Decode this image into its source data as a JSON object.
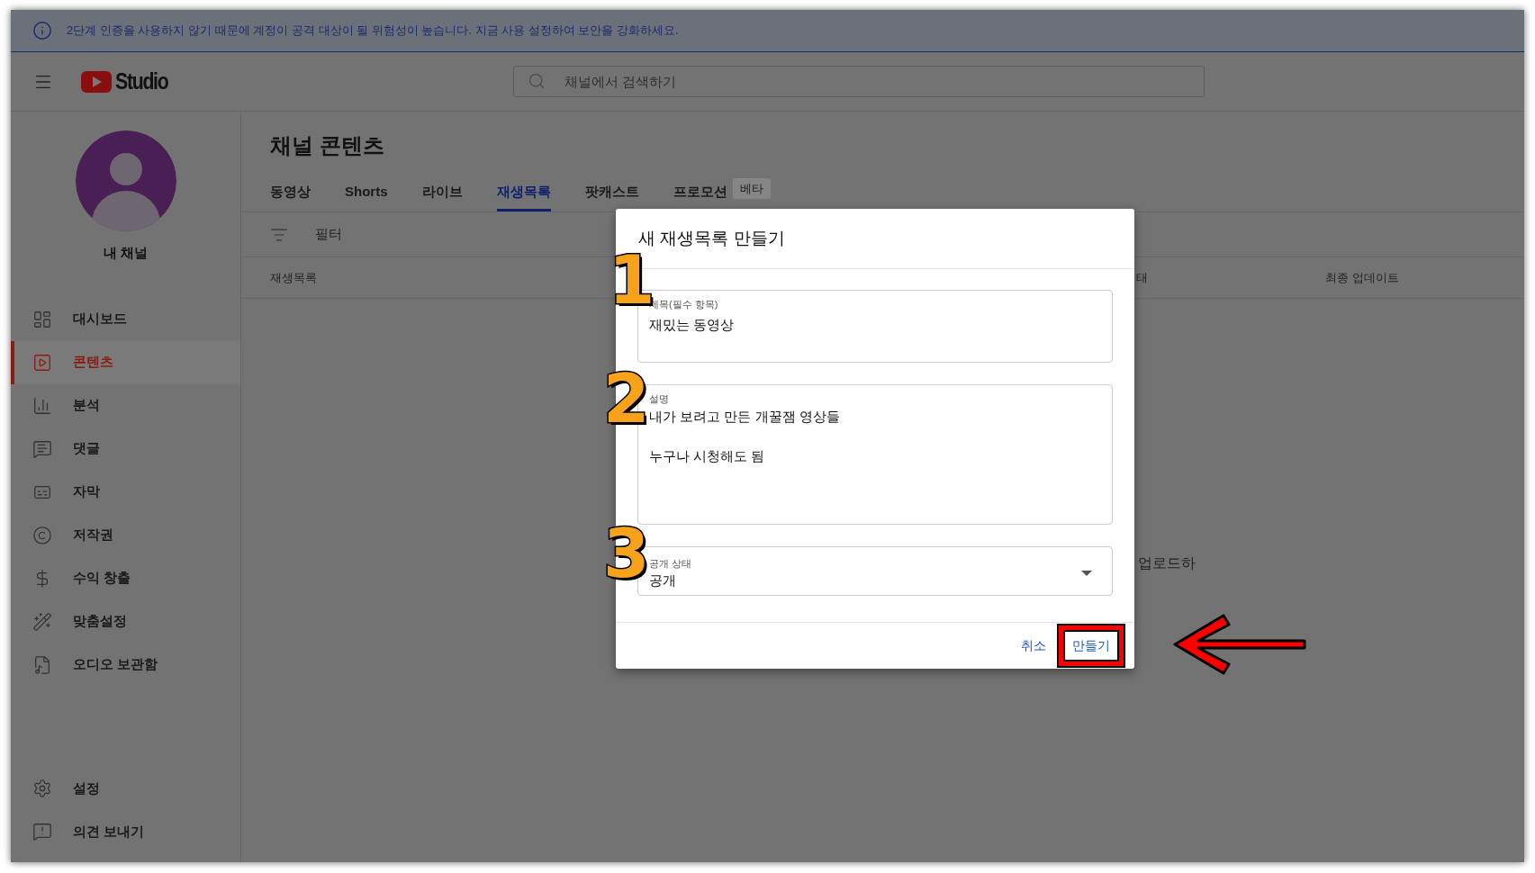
{
  "banner": {
    "text": "2단계 인증을 사용하지 않기 때문에 계정이 공격 대상이 될 위험성이 높습니다. 지금 사용 설정하여 보안을 강화하세요."
  },
  "header": {
    "logo": "Studio",
    "search": {
      "placeholder": "채널에서 검색하기"
    }
  },
  "sidebar": {
    "channel_name": "내 채널",
    "items": [
      {
        "label": "대시보드",
        "selected": false
      },
      {
        "label": "콘텐츠",
        "selected": true
      },
      {
        "label": "분석",
        "selected": false
      },
      {
        "label": "댓글",
        "selected": false
      },
      {
        "label": "자막",
        "selected": false
      },
      {
        "label": "저작권",
        "selected": false
      },
      {
        "label": "수익 창출",
        "selected": false
      },
      {
        "label": "맞춤설정",
        "selected": false
      },
      {
        "label": "오디오 보관함",
        "selected": false
      }
    ],
    "bottom_items": [
      {
        "label": "설정"
      },
      {
        "label": "의견 보내기"
      }
    ]
  },
  "page": {
    "title": "채널 콘텐츠",
    "tabs": [
      {
        "label": "동영상",
        "selected": false
      },
      {
        "label": "Shorts",
        "selected": false
      },
      {
        "label": "라이브",
        "selected": false
      },
      {
        "label": "재생목록",
        "selected": true
      },
      {
        "label": "팟캐스트",
        "selected": false
      },
      {
        "label": "프로모션",
        "selected": false,
        "badge": "베타"
      }
    ],
    "filter": "필터",
    "columns": [
      "재생목록",
      "태",
      "최종 업데이트"
    ],
    "empty_text": "업로드하"
  },
  "dialog": {
    "title": "새 재생목록 만들기",
    "title_field": {
      "label": "제목(필수 항목)",
      "value": "재밌는 동영상"
    },
    "description_field": {
      "label": "설명",
      "paragraphs": [
        "내가 보려고 만든 개꿀잼 영상들",
        "누구나 시청해도 됨"
      ]
    },
    "visibility_field": {
      "label": "공개 상태",
      "value": "공개"
    },
    "buttons": [
      {
        "label": "취소",
        "highlighted": false
      },
      {
        "label": "만들기",
        "highlighted": true
      }
    ]
  },
  "annotations": [
    {
      "label": "1"
    },
    {
      "label": "2"
    },
    {
      "label": "3"
    }
  ]
}
